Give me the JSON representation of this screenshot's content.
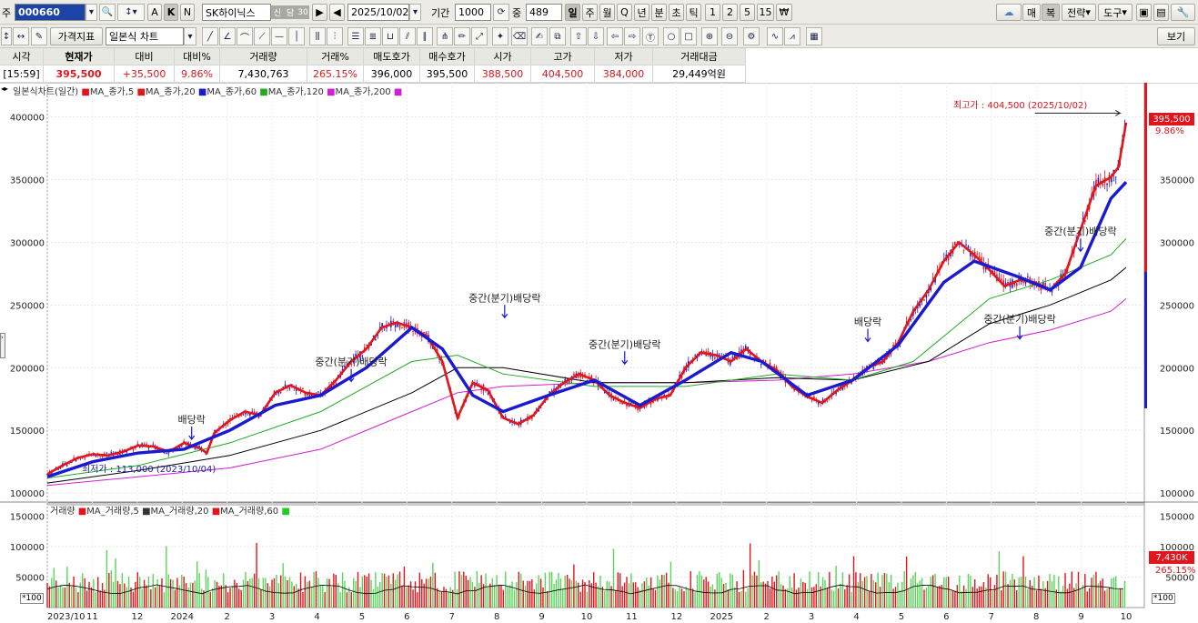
{
  "toolbar1": {
    "code_prefix": "주",
    "code": "000660",
    "btn_a": "A",
    "btn_k": "K",
    "btn_n": "N",
    "stock_name": "SK하이닉스",
    "tag1": "신",
    "tag2": "담",
    "tag3": "30",
    "date": "2025/10/02",
    "period_label": "기간",
    "period_value": "1000",
    "count_label": "중",
    "count_value": "489",
    "periods": [
      "일",
      "주",
      "월",
      "Q",
      "년",
      "분",
      "초",
      "틱",
      "1",
      "2",
      "5",
      "15"
    ],
    "right_buttons": [
      "매",
      "복",
      "전략",
      "도구"
    ]
  },
  "toolbar2": {
    "indicator_btn": "가격지표",
    "chart_type": "일본식 차트",
    "view_btn": "보기"
  },
  "quote": {
    "headers": [
      "시각",
      "현재가",
      "대비",
      "대비%",
      "거래량",
      "거래%",
      "매도호가",
      "매수호가",
      "시가",
      "고가",
      "저가",
      "거래대금"
    ],
    "values": [
      "[15:59]",
      "395,500",
      "+35,500",
      "9.86%",
      "7,430,763",
      "265.15%",
      "396,000",
      "395,500",
      "388,500",
      "404,500",
      "384,000",
      "29,449억원"
    ]
  },
  "legend": {
    "title": "일본식차트(일간)",
    "items": [
      {
        "label": "MA_종가,5",
        "color": "#e2141c"
      },
      {
        "label": "MA_종가,20",
        "color": "#e2141c"
      },
      {
        "label": "MA_종가,60",
        "color": "#1a1ad0"
      },
      {
        "label": "MA_종가,120",
        "color": "#22aa22"
      },
      {
        "label": "MA_종가,200",
        "color": "#d020d0"
      }
    ]
  },
  "volume_legend": {
    "title": "거래량",
    "items": [
      {
        "label": "MA_거래량,5",
        "color": "#e2141c"
      },
      {
        "label": "MA_거래량,20",
        "color": "#000000"
      },
      {
        "label": "MA_거래량,60",
        "color": "#22cc22"
      }
    ]
  },
  "annotations": {
    "max_label": "최고가 : 404,500 (2025/10/02)",
    "min_label": "최저가 : 113,000 (2023/10/04)",
    "events": [
      "배당락",
      "중간(분기)배당락",
      "중간(분기)배당락",
      "중간(분기)배당락",
      "배당락",
      "중간(분기)배당락",
      "중간(분기)배당락"
    ],
    "price_tag": "395,500",
    "pct_tag": "9.86%",
    "vol_tag": "7,430K",
    "vol_pct_tag": "265.15%",
    "unit": "*100"
  },
  "chart_data": {
    "type": "line",
    "title": "",
    "y_ticks": [
      100000,
      150000,
      200000,
      250000,
      300000,
      350000,
      400000
    ],
    "ylim": [
      95000,
      420000
    ],
    "vol_ticks": [
      50000,
      100000,
      150000
    ],
    "vol_ylim": [
      0,
      160000
    ],
    "x_labels": [
      "2023/10",
      "11",
      "12",
      "2024",
      "2",
      "3",
      "4",
      "5",
      "6",
      "7",
      "8",
      "9",
      "10",
      "11",
      "12",
      "2025",
      "2",
      "3",
      "4",
      "5",
      "6",
      "7",
      "8",
      "9",
      "10"
    ],
    "price": [
      [
        0,
        115000
      ],
      [
        10,
        122000
      ],
      [
        20,
        128000
      ],
      [
        30,
        131000
      ],
      [
        40,
        130000
      ],
      [
        50,
        133000
      ],
      [
        60,
        138000
      ],
      [
        70,
        137000
      ],
      [
        80,
        133000
      ],
      [
        90,
        140000
      ],
      [
        100,
        136000
      ],
      [
        105,
        132000
      ],
      [
        110,
        148000
      ],
      [
        120,
        158000
      ],
      [
        130,
        165000
      ],
      [
        140,
        162000
      ],
      [
        150,
        180000
      ],
      [
        160,
        186000
      ],
      [
        170,
        180000
      ],
      [
        180,
        178000
      ],
      [
        190,
        190000
      ],
      [
        200,
        205000
      ],
      [
        210,
        215000
      ],
      [
        220,
        232000
      ],
      [
        230,
        236000
      ],
      [
        240,
        232000
      ],
      [
        250,
        225000
      ],
      [
        260,
        205000
      ],
      [
        270,
        160000
      ],
      [
        280,
        188000
      ],
      [
        290,
        182000
      ],
      [
        300,
        160000
      ],
      [
        310,
        155000
      ],
      [
        320,
        162000
      ],
      [
        330,
        178000
      ],
      [
        340,
        188000
      ],
      [
        350,
        195000
      ],
      [
        360,
        190000
      ],
      [
        370,
        178000
      ],
      [
        380,
        172000
      ],
      [
        390,
        168000
      ],
      [
        400,
        175000
      ],
      [
        410,
        178000
      ],
      [
        420,
        200000
      ],
      [
        430,
        212000
      ],
      [
        440,
        210000
      ],
      [
        450,
        205000
      ],
      [
        460,
        215000
      ],
      [
        470,
        205000
      ],
      [
        480,
        198000
      ],
      [
        490,
        185000
      ],
      [
        500,
        177000
      ],
      [
        510,
        172000
      ],
      [
        520,
        182000
      ],
      [
        530,
        190000
      ],
      [
        540,
        200000
      ],
      [
        550,
        205000
      ],
      [
        560,
        220000
      ],
      [
        570,
        245000
      ],
      [
        580,
        262000
      ],
      [
        590,
        285000
      ],
      [
        600,
        300000
      ],
      [
        610,
        290000
      ],
      [
        620,
        278000
      ],
      [
        630,
        265000
      ],
      [
        640,
        270000
      ],
      [
        650,
        268000
      ],
      [
        660,
        262000
      ],
      [
        670,
        275000
      ],
      [
        680,
        310000
      ],
      [
        690,
        345000
      ],
      [
        700,
        352000
      ],
      [
        705,
        360000
      ],
      [
        710,
        395500
      ]
    ],
    "ma60": [
      [
        0,
        113000
      ],
      [
        30,
        125000
      ],
      [
        60,
        132000
      ],
      [
        90,
        135000
      ],
      [
        120,
        150000
      ],
      [
        150,
        170000
      ],
      [
        180,
        178000
      ],
      [
        210,
        200000
      ],
      [
        240,
        232000
      ],
      [
        260,
        215000
      ],
      [
        280,
        178000
      ],
      [
        300,
        165000
      ],
      [
        330,
        178000
      ],
      [
        360,
        190000
      ],
      [
        390,
        170000
      ],
      [
        420,
        190000
      ],
      [
        450,
        212000
      ],
      [
        470,
        205000
      ],
      [
        500,
        178000
      ],
      [
        530,
        190000
      ],
      [
        560,
        218000
      ],
      [
        590,
        268000
      ],
      [
        610,
        285000
      ],
      [
        640,
        272000
      ],
      [
        660,
        262000
      ],
      [
        680,
        280000
      ],
      [
        700,
        335000
      ],
      [
        710,
        348000
      ]
    ],
    "ma120": [
      [
        0,
        112000
      ],
      [
        60,
        122000
      ],
      [
        120,
        140000
      ],
      [
        180,
        165000
      ],
      [
        240,
        205000
      ],
      [
        270,
        210000
      ],
      [
        300,
        195000
      ],
      [
        360,
        185000
      ],
      [
        420,
        185000
      ],
      [
        480,
        195000
      ],
      [
        530,
        190000
      ],
      [
        570,
        205000
      ],
      [
        620,
        255000
      ],
      [
        660,
        270000
      ],
      [
        700,
        290000
      ],
      [
        710,
        303000
      ]
    ],
    "ma20b": [
      [
        0,
        108000
      ],
      [
        60,
        118000
      ],
      [
        120,
        130000
      ],
      [
        180,
        150000
      ],
      [
        240,
        180000
      ],
      [
        270,
        200000
      ],
      [
        300,
        200000
      ],
      [
        360,
        188000
      ],
      [
        420,
        188000
      ],
      [
        480,
        192000
      ],
      [
        530,
        190000
      ],
      [
        580,
        205000
      ],
      [
        620,
        235000
      ],
      [
        660,
        250000
      ],
      [
        700,
        270000
      ],
      [
        710,
        280000
      ]
    ],
    "ma200": [
      [
        0,
        106000
      ],
      [
        60,
        113000
      ],
      [
        120,
        120000
      ],
      [
        180,
        135000
      ],
      [
        240,
        165000
      ],
      [
        270,
        180000
      ],
      [
        300,
        185000
      ],
      [
        360,
        188000
      ],
      [
        420,
        188000
      ],
      [
        480,
        190000
      ],
      [
        530,
        195000
      ],
      [
        580,
        205000
      ],
      [
        620,
        220000
      ],
      [
        660,
        230000
      ],
      [
        700,
        245000
      ],
      [
        710,
        255000
      ]
    ]
  }
}
